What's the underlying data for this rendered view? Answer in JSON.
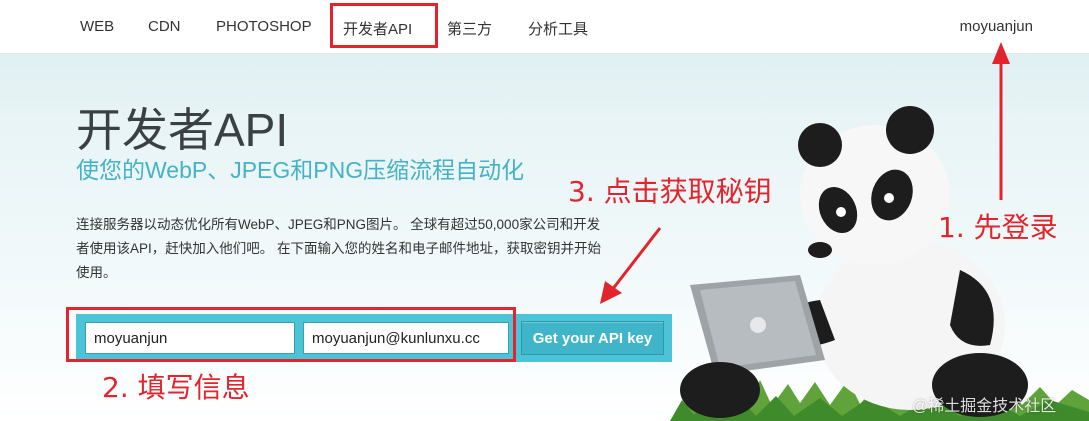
{
  "nav": {
    "items": [
      {
        "label": "WEB"
      },
      {
        "label": "CDN"
      },
      {
        "label": "PHOTOSHOP"
      },
      {
        "label": "开发者API"
      },
      {
        "label": "第三方"
      },
      {
        "label": "分析工具"
      }
    ],
    "user": "moyuanjun"
  },
  "hero": {
    "title": "开发者API",
    "subtitle": "使您的WebP、JPEG和PNG压缩流程自动化",
    "description": "连接服务器以动态优化所有WebP、JPEG和PNG图片。 全球有超过50,000家公司和开发者使用该API，赶快加入他们吧。 在下面输入您的姓名和电子邮件地址，获取密钥并开始使用。"
  },
  "form": {
    "name_value": "moyuanjun",
    "email_value": "moyuanjun@kunlunxu.cc",
    "submit_label": "Get your API key"
  },
  "annotations": {
    "step1": "1. 先登录",
    "step2": "2. 填写信息",
    "step3": "3. 点击获取秘钥",
    "color": "#e2242c"
  },
  "watermark": "@稀土掘金技术社区",
  "colors": {
    "accent": "#46b2c6",
    "button": "#40b5c9",
    "highlight": "#e2242c"
  }
}
